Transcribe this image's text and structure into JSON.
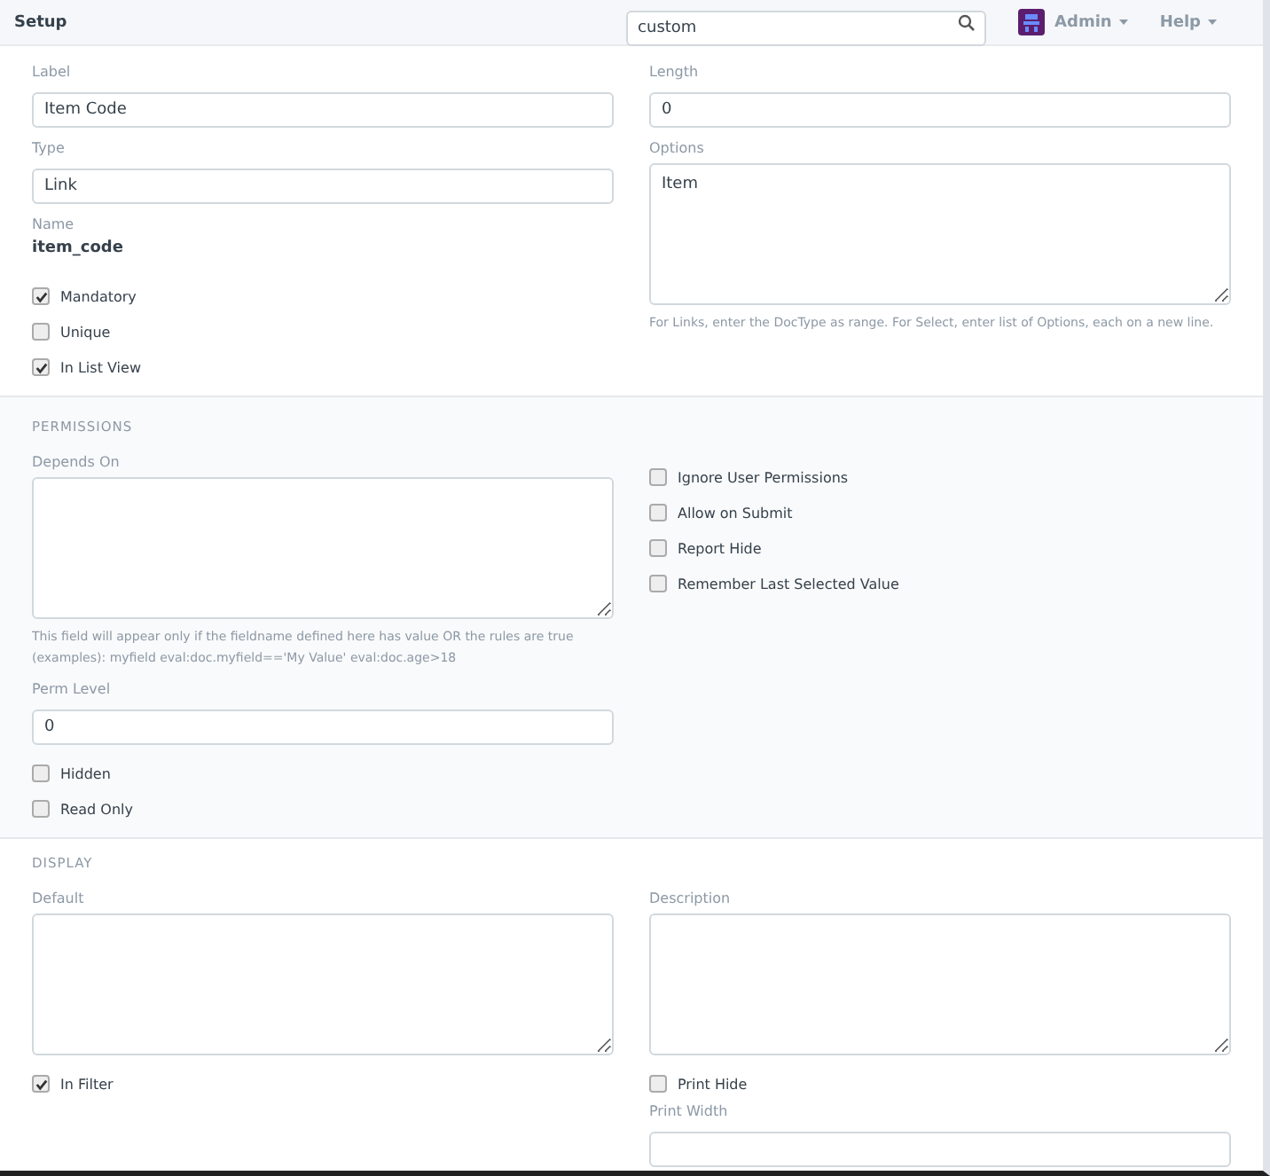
{
  "topbar": {
    "title": "Setup",
    "search": {
      "value": "custom"
    },
    "user": "Admin",
    "help": "Help"
  },
  "sections": [
    {
      "shaded": false,
      "left": [
        {
          "kind": "input",
          "label": "Label",
          "value": "Item Code"
        },
        {
          "kind": "input",
          "label": "Type",
          "value": "Link"
        },
        {
          "kind": "static",
          "label": "Name",
          "value": "item_code"
        },
        {
          "kind": "check",
          "label": "Mandatory",
          "checked": true
        },
        {
          "kind": "check",
          "label": "Unique",
          "checked": false
        },
        {
          "kind": "check",
          "label": "In List View",
          "checked": true
        }
      ],
      "right": [
        {
          "kind": "input",
          "label": "Length",
          "value": "0"
        },
        {
          "kind": "textarea",
          "label": "Options",
          "value": "Item",
          "help": "For Links, enter the DocType as range. For Select, enter list of Options, each on a new line."
        }
      ]
    },
    {
      "heading": "PERMISSIONS",
      "shaded": true,
      "left": [
        {
          "kind": "textarea",
          "label": "Depends On",
          "help": "This field will appear only if the fieldname defined here has value OR the rules are true (examples): myfield eval:doc.myfield=='My Value' eval:doc.age>18"
        },
        {
          "kind": "input",
          "label": "Perm Level",
          "value": "0"
        },
        {
          "kind": "check",
          "label": "Hidden",
          "checked": false
        },
        {
          "kind": "check",
          "label": "Read Only",
          "checked": false
        }
      ],
      "right": [
        {
          "kind": "spacer"
        },
        {
          "kind": "check",
          "label": "Ignore User Permissions",
          "checked": false
        },
        {
          "kind": "check",
          "label": "Allow on Submit",
          "checked": false
        },
        {
          "kind": "check",
          "label": "Report Hide",
          "checked": false
        },
        {
          "kind": "check",
          "label": "Remember Last Selected Value",
          "checked": false
        }
      ]
    },
    {
      "heading": "DISPLAY",
      "shaded": false,
      "left": [
        {
          "kind": "textarea",
          "label": "Default"
        },
        {
          "kind": "check",
          "label": "In Filter",
          "checked": true
        }
      ],
      "right": [
        {
          "kind": "textarea",
          "label": "Description"
        },
        {
          "kind": "check",
          "label": "Print Hide",
          "checked": false
        },
        {
          "kind": "input",
          "label": "Print Width"
        }
      ]
    }
  ]
}
